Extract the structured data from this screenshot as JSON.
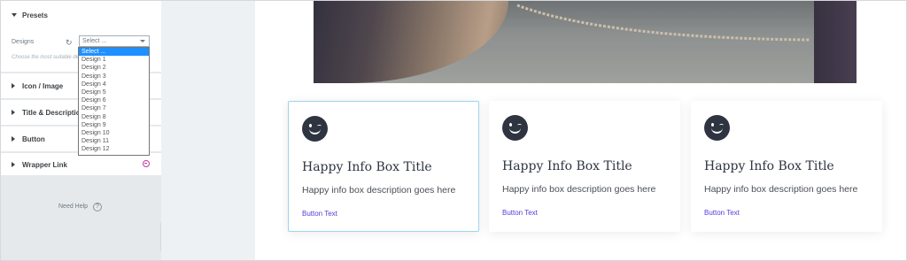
{
  "panel": {
    "presets": {
      "heading": "Presets",
      "designs_label": "Designs",
      "select_value": "Select ...",
      "help_text": "Choose the most suitable design"
    },
    "dropdown_options": [
      "Select ...",
      "Design 1",
      "Design 2",
      "Design 3",
      "Design 4",
      "Design 5",
      "Design 6",
      "Design 7",
      "Design 8",
      "Design 9",
      "Design 10",
      "Design 11",
      "Design 12"
    ],
    "sections": [
      "Icon / Image",
      "Title & Description",
      "Button",
      "Wrapper Link"
    ],
    "need_help": "Need Help",
    "help_icon": "?",
    "collapse_icon": "‹"
  },
  "cards": [
    {
      "title": "Happy Info Box Title",
      "description": "Happy info box description goes here",
      "button": "Button Text"
    },
    {
      "title": "Happy Info Box Title",
      "description": "Happy info box description goes here",
      "button": "Button Text"
    },
    {
      "title": "Happy Info Box Title",
      "description": "Happy info box description goes here",
      "button": "Button Text"
    }
  ],
  "icons": {
    "card_icon": "wink-emoji-icon",
    "refresh": "refresh-icon",
    "wrapper_link": "pro-feature-icon"
  },
  "colors": {
    "accent_link": "#5a3bd6",
    "dropdown_selected": "#1e90ff",
    "active_card_border": "#9ed4ec",
    "panel_bg": "#e6e9ec"
  }
}
